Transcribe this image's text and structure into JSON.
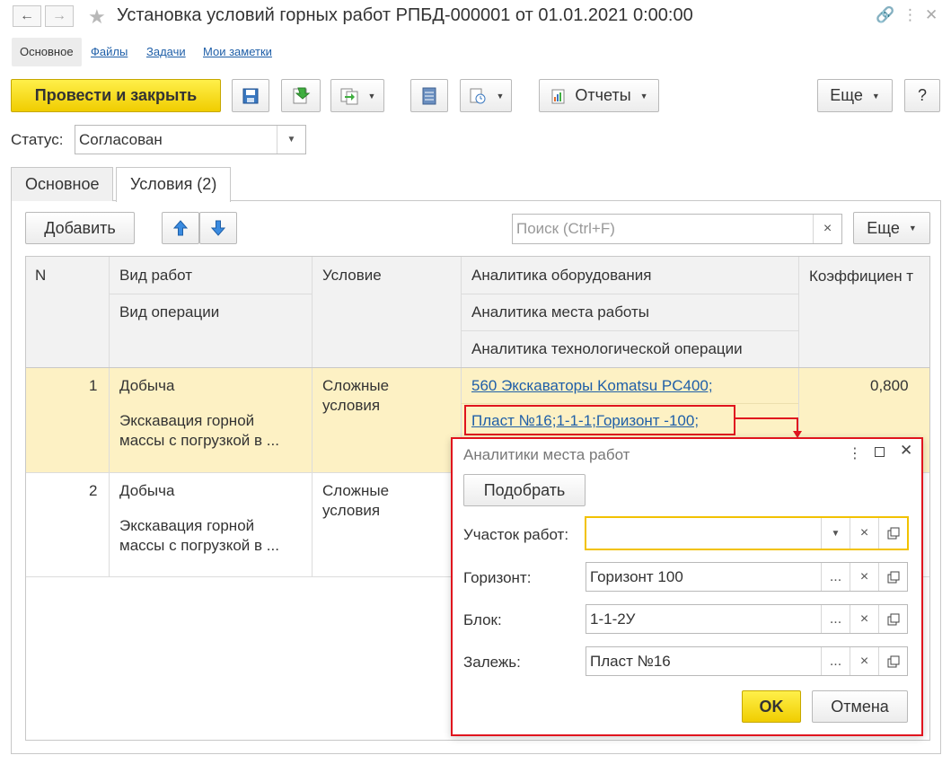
{
  "window": {
    "title": "Установка условий горных работ РПБД-000001 от 01.01.2021 0:00:00",
    "back_icon": "arrow-left-icon",
    "forward_icon": "arrow-right-icon",
    "star_icon": "star-icon"
  },
  "top_tabs": [
    {
      "label": "Основное",
      "active": true
    },
    {
      "label": "Файлы",
      "active": false
    },
    {
      "label": "Задачи",
      "active": false
    },
    {
      "label": "Мои заметки",
      "active": false
    }
  ],
  "toolbar": {
    "post_and_close": "Провести и закрыть",
    "reports": "Отчеты",
    "more": "Еще",
    "help": "?"
  },
  "status": {
    "label": "Статус:",
    "value": "Согласован"
  },
  "content_tabs": [
    {
      "label": "Основное",
      "active": false
    },
    {
      "label": "Условия (2)",
      "active": true
    }
  ],
  "table_toolbar": {
    "add": "Добавить",
    "search_placeholder": "Поиск (Ctrl+F)",
    "clear": "×",
    "more": "Еще"
  },
  "table": {
    "headers": {
      "n": "N",
      "work_type": "Вид работ",
      "operation_type": "Вид операции",
      "condition": "Условие",
      "equipment_analytics": "Аналитика оборудования",
      "workplace_analytics": "Аналитика места работы",
      "tech_op_analytics": "Аналитика технологической операции",
      "coef": "Коэффициен т"
    },
    "rows": [
      {
        "n": "1",
        "work_type": "Добыча",
        "operation_line1": "Экскавация горной",
        "operation_line2": "массы с погрузкой в ...",
        "condition_line1": "Сложные",
        "condition_line2": "условия",
        "equipment": "560 Экскаваторы Komatsu PC400;",
        "workplace": "Пласт №16;1-1-1;Горизонт -100;",
        "coef": "0,800"
      },
      {
        "n": "2",
        "work_type": "Добыча",
        "operation_line1": "Экскавация горной",
        "operation_line2": "массы с погрузкой в ...",
        "condition_line1": "Сложные",
        "condition_line2": "условия"
      }
    ]
  },
  "popup": {
    "title": "Аналитики места работ",
    "select": "Подобрать",
    "fields": [
      {
        "label": "Участок работ:",
        "value": ""
      },
      {
        "label": "Горизонт:",
        "value": "Горизонт 100"
      },
      {
        "label": "Блок:",
        "value": "1-1-2У"
      },
      {
        "label": "Залежь:",
        "value": "Пласт №16"
      }
    ],
    "ok": "OK",
    "cancel": "Отмена",
    "ellipsis": "..."
  },
  "colors": {
    "accent_yellow": "#f5d800",
    "highlight_row": "#fdf1c4",
    "link": "#1f5fa8",
    "callout_red": "#e0141e"
  }
}
